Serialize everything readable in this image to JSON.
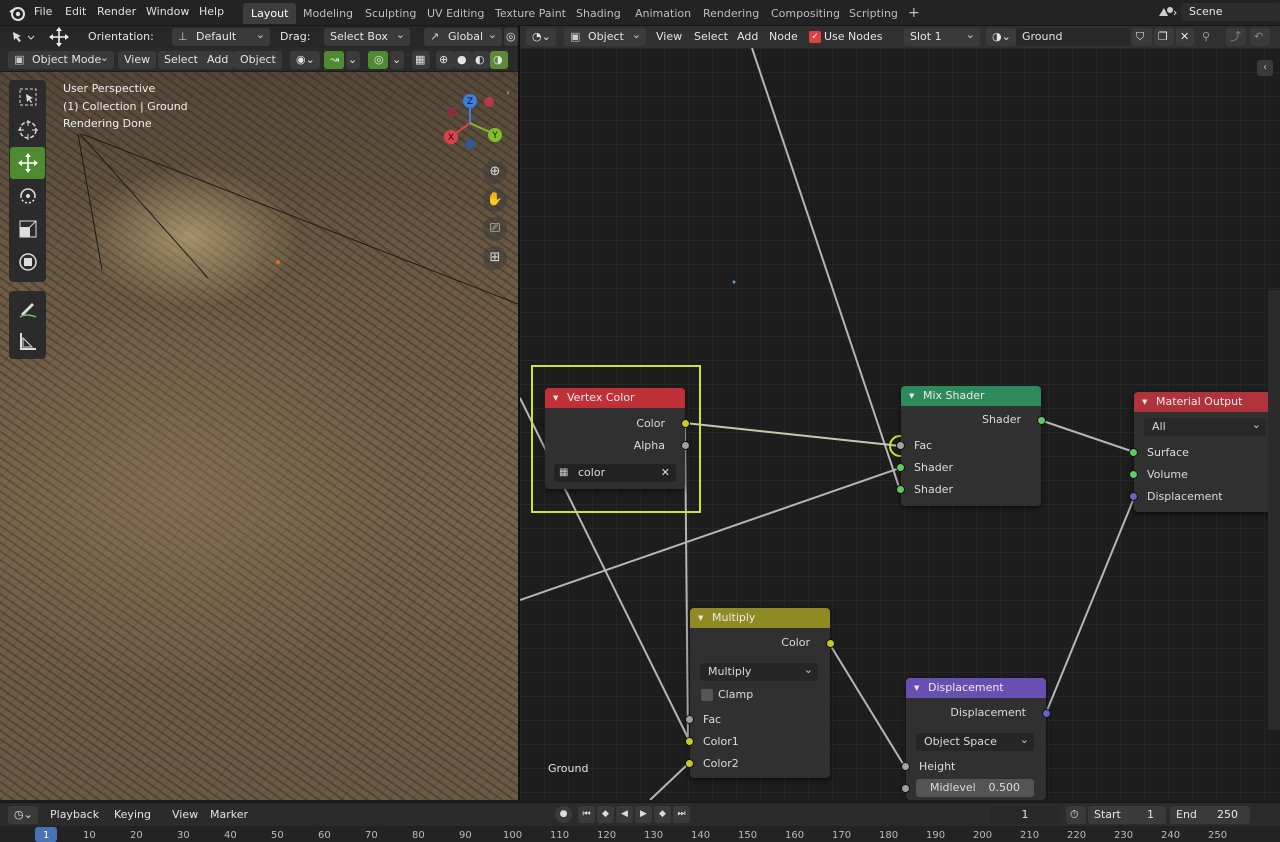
{
  "menubar": {
    "items": [
      "File",
      "Edit",
      "Render",
      "Window",
      "Help"
    ],
    "workspaces": [
      "Layout",
      "Modeling",
      "Sculpting",
      "UV Editing",
      "Texture Paint",
      "Shading",
      "Animation",
      "Rendering",
      "Compositing",
      "Scripting"
    ],
    "active_workspace": "Layout",
    "add_workspace": "+",
    "scene": "Scene"
  },
  "viewport_header": {
    "orientation_label": "Orientation:",
    "orientation_value": "Default",
    "drag_label": "Drag:",
    "drag_value": "Select Box",
    "transform_value": "Global",
    "mode": "Object Mode",
    "menus": [
      "View",
      "Select",
      "Add",
      "Object"
    ]
  },
  "viewport": {
    "perspective": "User Perspective",
    "collection": "(1) Collection | Ground",
    "status": "Rendering Done",
    "object_name": "Ground",
    "gizmo": {
      "x": "X",
      "y": "Y",
      "z": "Z"
    }
  },
  "node_editor_header": {
    "type": "Object",
    "menus": [
      "View",
      "Select",
      "Add",
      "Node"
    ],
    "use_nodes_label": "Use Nodes",
    "use_nodes_checked": true,
    "slot": "Slot 1",
    "material": "Ground"
  },
  "nodes": {
    "vertex_color": {
      "title": "Vertex Color",
      "outputs": [
        "Color",
        "Alpha"
      ],
      "layer": "color",
      "color": "#c03038"
    },
    "mix_shader": {
      "title": "Mix Shader",
      "output": "Shader",
      "inputs": [
        "Fac",
        "Shader",
        "Shader"
      ],
      "color": "#2d8a5a"
    },
    "material_output": {
      "title": "Material Output",
      "target": "All",
      "inputs": [
        "Surface",
        "Volume",
        "Displacement"
      ],
      "color": "#b0323a"
    },
    "multiply": {
      "title": "Multiply",
      "output": "Color",
      "blend": "Multiply",
      "clamp_label": "Clamp",
      "inputs": [
        "Fac",
        "Color1",
        "Color2"
      ],
      "color": "#8f8a24"
    },
    "displacement": {
      "title": "Displacement",
      "output": "Displacement",
      "space": "Object Space",
      "inputs": [
        "Height"
      ],
      "midlevel_label": "Midlevel",
      "midlevel_value": "0.500",
      "color": "#6a4fb3"
    }
  },
  "highlight_color": "#c8e632",
  "timeline": {
    "menus": [
      "Playback",
      "Keying",
      "View",
      "Marker"
    ],
    "current_frame": "1",
    "start_label": "Start",
    "start": "1",
    "end_label": "End",
    "end": "250",
    "ticks": [
      "1",
      "10",
      "20",
      "30",
      "40",
      "50",
      "60",
      "70",
      "80",
      "90",
      "100",
      "110",
      "120",
      "130",
      "140",
      "150",
      "160",
      "170",
      "180",
      "190",
      "200",
      "210",
      "220",
      "230",
      "240",
      "250"
    ]
  }
}
